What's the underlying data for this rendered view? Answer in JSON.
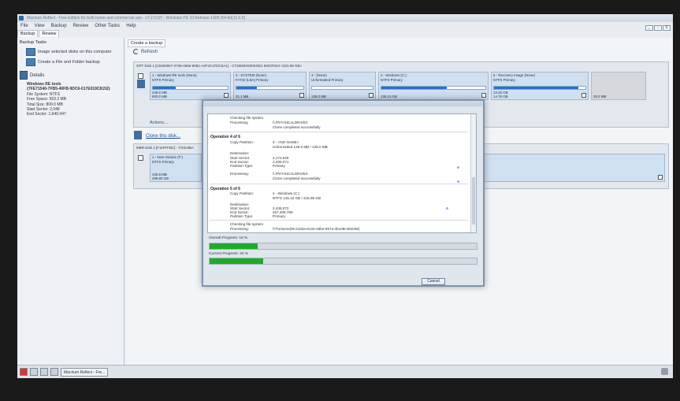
{
  "window": {
    "title": "Macrium Reflect - Free Edition for both home and commercial use - v7.2.5107 - Windows PE 10 Release 1909 (64-bit) [1.0.5]",
    "controls": [
      "_",
      "▫",
      "X"
    ]
  },
  "menu": [
    "File",
    "View",
    "Backup",
    "Review",
    "Other Tasks",
    "Help"
  ],
  "tabs": [
    "Backup",
    "Review"
  ],
  "sidebar": {
    "heading": "Backup Tasks",
    "tasks": [
      "Image selected disks on this computer",
      "Create a File and Folder backup"
    ],
    "details_label": "Details",
    "details": {
      "name": "Windows RE tools",
      "guid": "{7FE71540-7FB5-40FB-9DC6-017E019C8152}",
      "fs": "File System: NTFS",
      "free": "Free Space: 553.2 MB",
      "total": "Total Size: 800.0 MB",
      "start": "Start Sector: 2,048",
      "end": "End Sector: 1,640,447"
    }
  },
  "main": {
    "tab": "Create a backup",
    "refresh": "Refresh",
    "disk1": {
      "header": "GPT Disk 1 [C5450807-2736-4656-8081-A2F4C47DC6A1] - CT250MX500SSD1 M3CR023 <231.89 GB>",
      "partitions": [
        {
          "title": "1 - Windows RE tools (None)",
          "fs": "NTFS Primary",
          "fill": 0.31,
          "used": "246.5 MB",
          "total": "800.0 MB",
          "checked": true
        },
        {
          "title": "2 - SYSTEM (None)",
          "fs": "FAT32 (LBA) Primary",
          "fill": 0.3,
          "used": "31.1 MB",
          "total": "",
          "checked": false
        },
        {
          "title": "3 - (None)",
          "fs": "Unformatted Primary",
          "fill": 0,
          "used": "128.0 MB",
          "total": "",
          "checked": false
        },
        {
          "title": "4 - Windows (C:)",
          "fs": "NTFS Primary",
          "fill": 0.63,
          "used": "135.10 GB",
          "total": "",
          "checked": true
        },
        {
          "title": "5 - Recovery Image (None)",
          "fs": "NTFS Primary",
          "fill": 0.92,
          "used": "13.33 GB",
          "total": "14.78 GB",
          "checked": true
        }
      ],
      "unallocated": "28.2 MB",
      "actions": "Actions..."
    },
    "clone_link": "Clone this disk...",
    "disk2": {
      "header": "MBR Disk 2 [F11FFFBC] - TOSHIBA",
      "partitions": [
        {
          "title": "1 - New Volume (F:)",
          "fs": "NTFS Primary",
          "used": "430.8 MB",
          "total": "299.80 GB"
        }
      ]
    }
  },
  "dialog": {
    "log": [
      {
        "label": "Checking file system",
        "value": ""
      },
      {
        "label": "Processing",
        "value": "\\\\.\\PHYSICALDRIVE0"
      },
      {
        "label": "",
        "value": "Clone completed successfully"
      }
    ],
    "op4": {
      "heading": "Operation 4 of 6",
      "copy_label": "Copy Partition:",
      "copy_value": "3 - <NO NAME>",
      "copy_sub": "Unformatted 128.0 MB / 128.0 MB",
      "dest_label": "Destination:",
      "start_label": "Start Sector:",
      "start_value": "2,172,928",
      "end_label": "End Sector:",
      "end_value": "2,435,071",
      "ptype_label": "Partition Type:",
      "ptype_value": "Primary",
      "proc_label": "Processing:",
      "proc_value": "\\\\.\\PHYSICALDRIVE0",
      "done": "Clone completed successfully"
    },
    "op5": {
      "heading": "Operation 5 of 6",
      "copy_label": "Copy Partition:",
      "copy_value": "4 - Windows (C:)",
      "copy_sub": "NTFS 135.10 GB / 216.95 GB",
      "dest_label": "Destination:",
      "start_label": "Start Sector:",
      "start_value": "2,435,072",
      "end_label": "End Sector:",
      "end_value": "457,409,799",
      "ptype_label": "Partition Type:",
      "ptype_value": "Primary",
      "check_label": "Checking file system",
      "proc_label": "Processing:",
      "proc_value": "\\\\?\\Volume{9C2183a-6134-49be-957a-4bc08c492028}"
    },
    "overall_label": "Overall Progress:  18 %",
    "overall_progress": 0.18,
    "current_label": "Current Progress:  20 %",
    "current_progress": 0.2,
    "cancel": "Cancel"
  },
  "taskbar": {
    "task": "Macrium Reflect - Fre..."
  }
}
